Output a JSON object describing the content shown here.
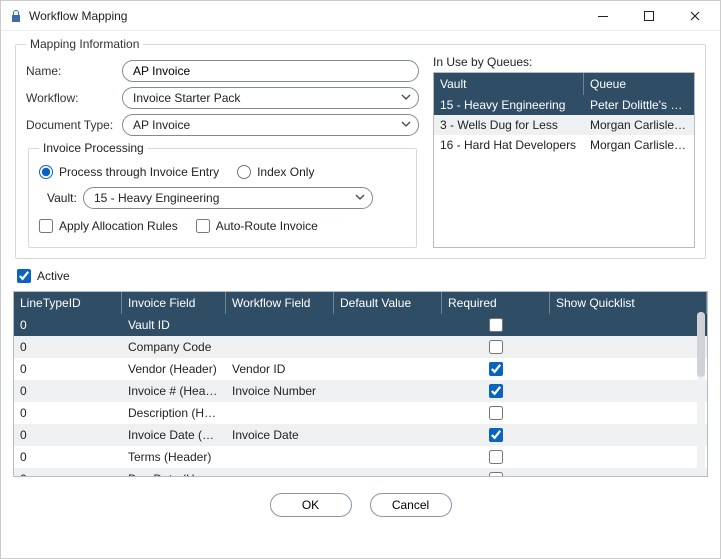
{
  "window": {
    "title": "Workflow Mapping"
  },
  "mapping": {
    "legend": "Mapping Information",
    "name_label": "Name:",
    "name_value": "AP Invoice",
    "workflow_label": "Workflow:",
    "workflow_value": "Invoice Starter Pack",
    "doctype_label": "Document Type:",
    "doctype_value": "AP Invoice",
    "invoice_processing": {
      "legend": "Invoice Processing",
      "radio_entry": "Process through Invoice Entry",
      "radio_index": "Index Only",
      "vault_label": "Vault:",
      "vault_value": "15 - Heavy Engineering",
      "apply_alloc": "Apply Allocation Rules",
      "auto_route": "Auto-Route Invoice"
    },
    "in_use_label": "In Use by Queues:",
    "queue_headers": {
      "vault": "Vault",
      "queue": "Queue"
    },
    "queues": [
      {
        "vault": "15 - Heavy Engineering",
        "queue": "Peter Dolittle's Queue"
      },
      {
        "vault": "3 - Wells Dug for Less",
        "queue": "Morgan Carlisle's Queue"
      },
      {
        "vault": "16 - Hard Hat Developers",
        "queue": "Morgan Carlisle's Queue"
      }
    ]
  },
  "active_label": "Active",
  "grid": {
    "headers": {
      "c0": "LineTypeID",
      "c1": "Invoice Field",
      "c2": "Workflow Field",
      "c3": "Default Value",
      "c4": "Required",
      "c5": "Show Quicklist"
    },
    "rows": [
      {
        "lt": "0",
        "inv": "Vault ID",
        "wf": "",
        "def": "",
        "req": false
      },
      {
        "lt": "0",
        "inv": "Company Code",
        "wf": "",
        "def": "",
        "req": false
      },
      {
        "lt": "0",
        "inv": "Vendor   (Header)",
        "wf": "Vendor ID",
        "def": "",
        "req": true
      },
      {
        "lt": "0",
        "inv": "Invoice #   (Header)",
        "wf": "Invoice Number",
        "def": "",
        "req": true
      },
      {
        "lt": "0",
        "inv": "Description   (Hea...",
        "wf": "",
        "def": "",
        "req": false
      },
      {
        "lt": "0",
        "inv": "Invoice Date   (He...",
        "wf": "Invoice Date",
        "def": "",
        "req": true
      },
      {
        "lt": "0",
        "inv": "Terms   (Header)",
        "wf": "",
        "def": "",
        "req": false
      },
      {
        "lt": "0",
        "inv": "Due Date   (Header)",
        "wf": "",
        "def": "",
        "req": false
      }
    ]
  },
  "footer": {
    "ok": "OK",
    "cancel": "Cancel"
  }
}
